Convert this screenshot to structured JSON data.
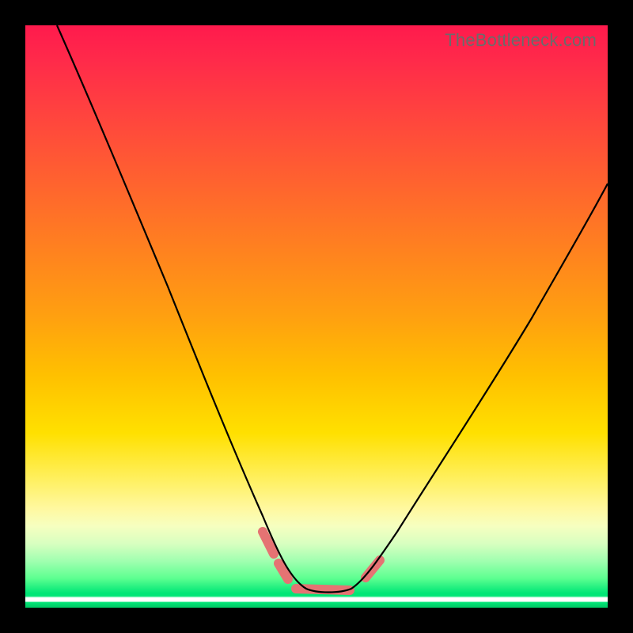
{
  "watermark": "TheBottleneck.com",
  "chart_data": {
    "type": "line",
    "title": "",
    "xlabel": "",
    "ylabel": "",
    "xlim": [
      0,
      100
    ],
    "ylim": [
      0,
      100
    ],
    "x": [
      0,
      5,
      10,
      15,
      20,
      25,
      30,
      35,
      40,
      42,
      45,
      48,
      50,
      52,
      55,
      60,
      65,
      70,
      75,
      80,
      85,
      90,
      95,
      100
    ],
    "values": [
      100,
      90,
      80,
      70,
      60,
      50,
      40,
      28,
      15,
      8,
      2,
      0,
      0,
      0,
      2,
      8,
      15,
      22,
      30,
      37,
      44,
      50,
      56,
      62
    ],
    "series": [
      {
        "name": "bottleneck-curve",
        "x_ref": "x",
        "values_ref": "values"
      }
    ],
    "highlight_segments": [
      {
        "x_start": 38,
        "x_end": 43
      },
      {
        "x_start": 44,
        "x_end": 55
      },
      {
        "x_start": 57,
        "x_end": 60
      }
    ],
    "gradient_stops": [
      {
        "pos": 0,
        "color": "#ff1a4d"
      },
      {
        "pos": 50,
        "color": "#ffa010"
      },
      {
        "pos": 78,
        "color": "#fff8a0"
      },
      {
        "pos": 97,
        "color": "#00e676"
      },
      {
        "pos": 100,
        "color": "#00c864"
      }
    ]
  }
}
